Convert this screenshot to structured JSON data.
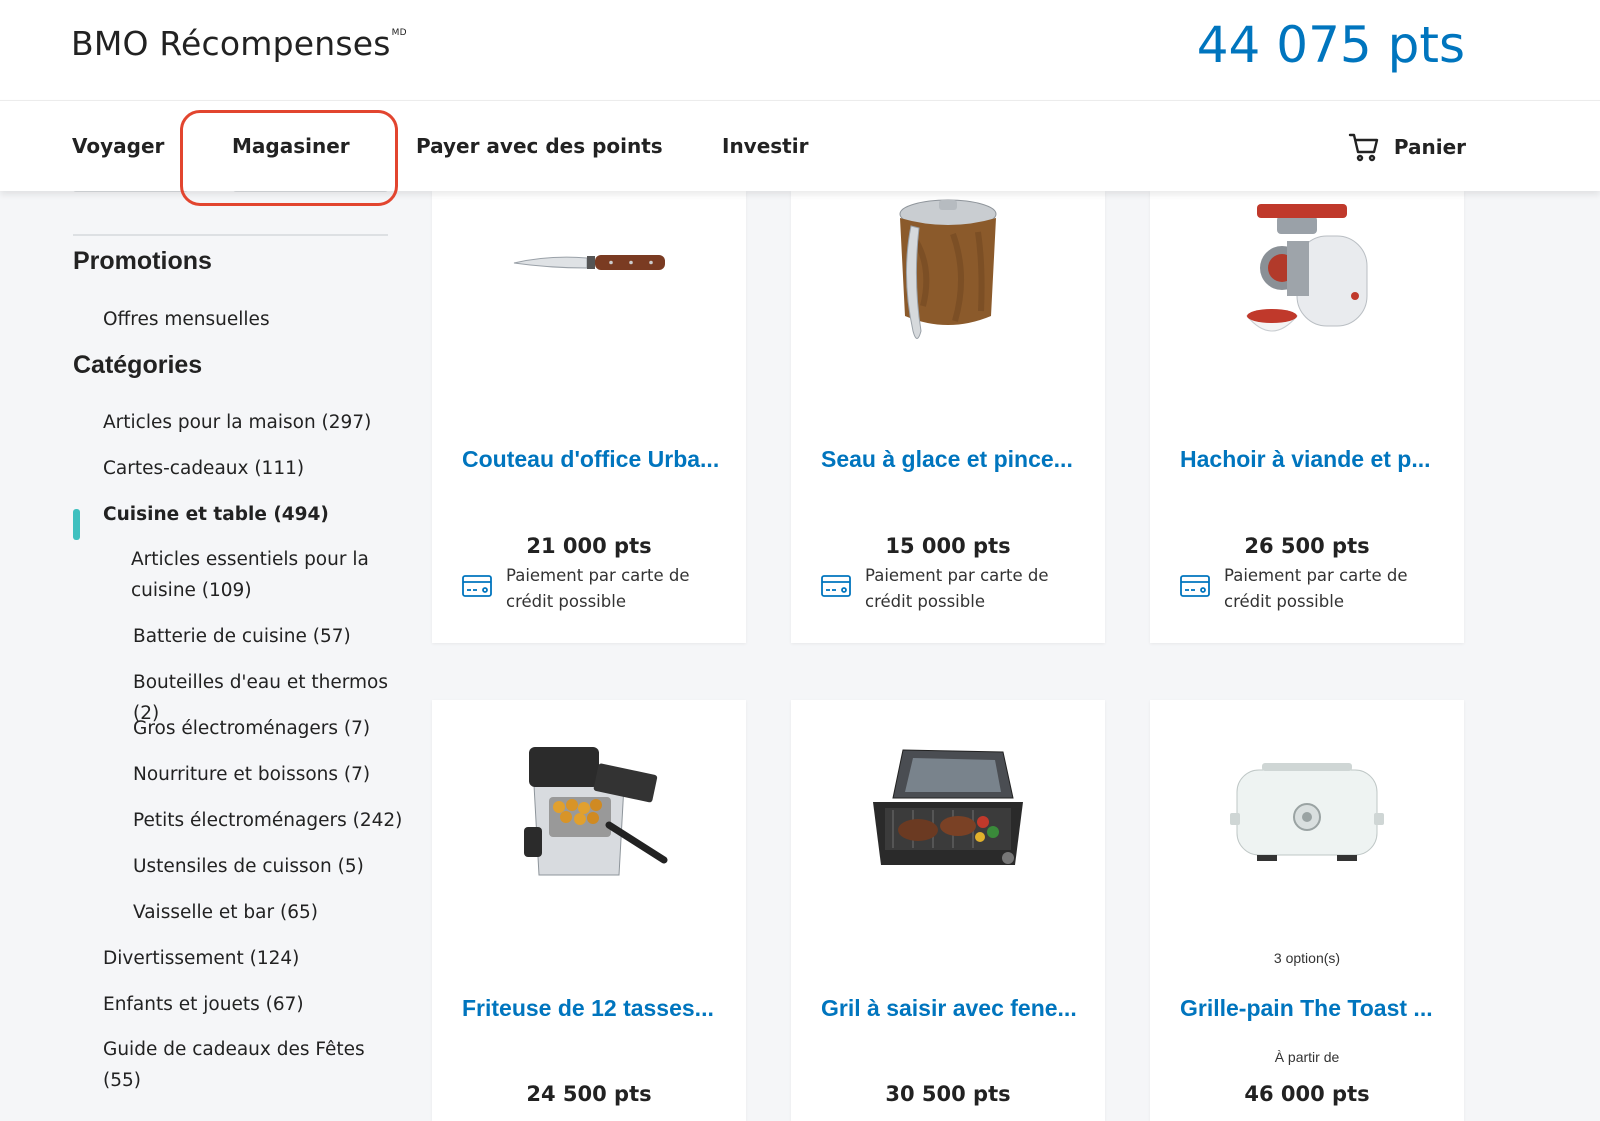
{
  "header": {
    "brand": "BMO Récompenses",
    "brand_mark": "MD",
    "points": "44 075 pts"
  },
  "nav": {
    "items": [
      "Voyager",
      "Magasiner",
      "Payer avec des points",
      "Investir"
    ],
    "active": "Magasiner",
    "cart_label": "Panier"
  },
  "sidebar": {
    "promotions_heading": "Promotions",
    "promotions_items": [
      "Offres mensuelles"
    ],
    "categories_heading": "Catégories",
    "categories": [
      "Articles pour la maison (297)",
      "Cartes-cadeaux (111)",
      "Cuisine et table (494)",
      "Divertissement (124)",
      "Enfants et jouets (67)",
      "Guide de cadeaux des Fêtes (55)"
    ],
    "subcategories": [
      "Articles essentiels pour la cuisine (109)",
      "Batterie de cuisine (57)",
      "Bouteilles d'eau et thermos (2)",
      "Gros électroménagers (7)",
      "Nourriture et boissons (7)",
      "Petits électroménagers (242)",
      "Ustensiles de cuisson (5)",
      "Vaisselle et bar (65)"
    ]
  },
  "products": [
    {
      "title": "Couteau d'office Urba...",
      "price": "21 000 pts",
      "payment": "Paiement par carte de crédit possible",
      "icon": "knife-image"
    },
    {
      "title": "Seau à glace et pince...",
      "price": "15 000 pts",
      "payment": "Paiement par carte de crédit possible",
      "icon": "ice-bucket-image"
    },
    {
      "title": "Hachoir à viande et p...",
      "price": "26 500 pts",
      "payment": "Paiement par carte de crédit possible",
      "icon": "meat-grinder-image"
    },
    {
      "title": "Friteuse de 12 tasses...",
      "price": "24 500 pts",
      "icon": "fryer-image"
    },
    {
      "title": "Gril à saisir avec fene...",
      "price": "30 500 pts",
      "icon": "grill-image"
    },
    {
      "title": "Grille-pain The Toast ...",
      "price": "46 000 pts",
      "options": "3 option(s)",
      "from_label": "À partir de",
      "icon": "toaster-image"
    }
  ],
  "colors": {
    "brand_blue": "#0075be",
    "active_teal": "#3fc0bf",
    "highlight_red": "#e2452f"
  }
}
